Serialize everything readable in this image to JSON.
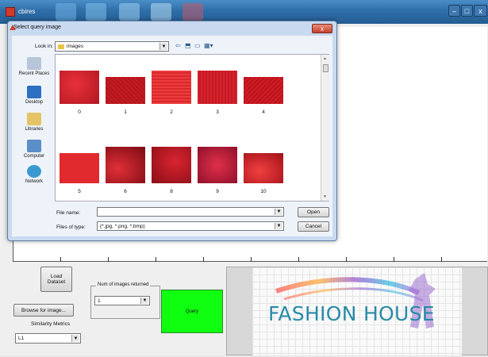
{
  "app": {
    "title": "cbires",
    "window_controls": [
      "–",
      "□",
      "x"
    ]
  },
  "dialog": {
    "title": "Select query image",
    "close_label": "x",
    "look_in_label": "Look in:",
    "look_in_value": "images",
    "places": [
      {
        "label": "Recent Places",
        "icon": "recent-places-icon"
      },
      {
        "label": "Desktop",
        "icon": "desktop-icon"
      },
      {
        "label": "Libraries",
        "icon": "libraries-icon"
      },
      {
        "label": "Computer",
        "icon": "computer-icon"
      },
      {
        "label": "Network",
        "icon": "network-icon"
      }
    ],
    "files": [
      {
        "name": "0"
      },
      {
        "name": "1"
      },
      {
        "name": "2"
      },
      {
        "name": "3"
      },
      {
        "name": "4"
      },
      {
        "name": "5"
      },
      {
        "name": "6"
      },
      {
        "name": "8"
      },
      {
        "name": "9"
      },
      {
        "name": "10"
      }
    ],
    "file_name_label": "File name:",
    "file_name_value": "",
    "files_of_type_label": "Files of type:",
    "files_of_type_value": "(*.jpg, *.png, *.bmp)",
    "open_label": "Open",
    "cancel_label": "Cancel"
  },
  "controls": {
    "load_dataset_label": "Load Dataset",
    "num_images_legend": "Num of images returned",
    "num_images_value": "1",
    "query_label": "Query",
    "browse_label": "Browse for image...",
    "similarity_label": "Similarity Metrics",
    "similarity_value": "L1"
  },
  "logo": {
    "text": "FASHION HOUSE"
  },
  "colors": {
    "query_button": "#10ff10",
    "titlebar": "#2f6ea8",
    "logo_text": "#2a8aa8"
  }
}
